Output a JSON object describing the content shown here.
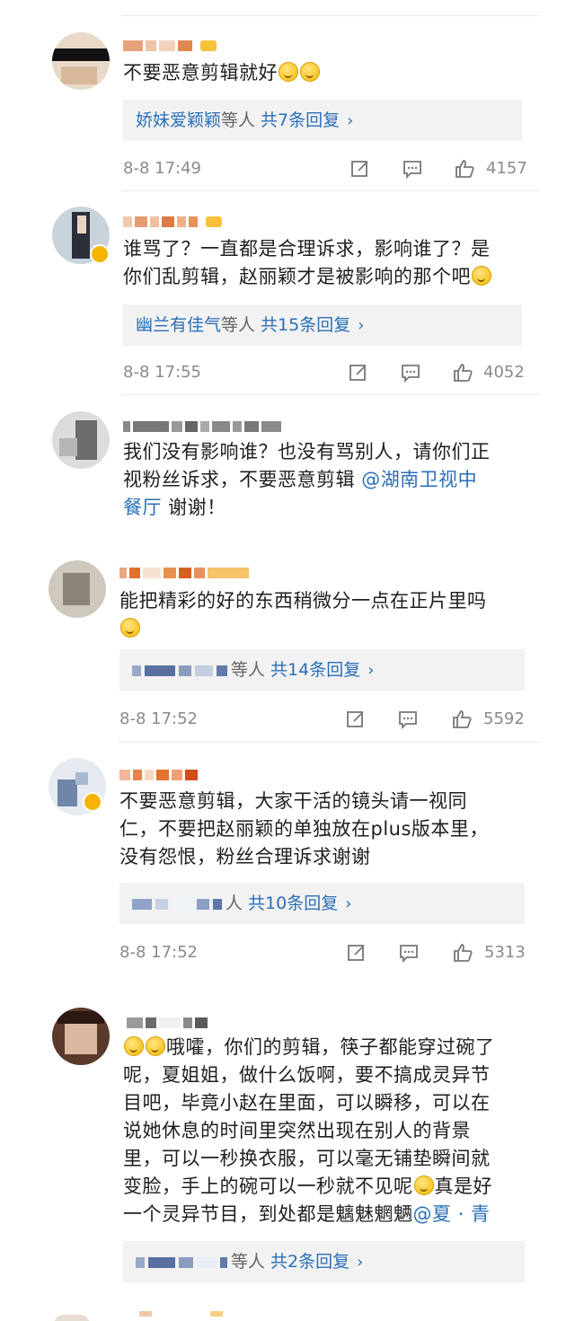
{
  "comments": [
    {
      "text": "不要恶意剪辑就好",
      "emojis_after": 2,
      "reply_names": "娇妹爱颖颖",
      "reply_mid": "等人",
      "reply_count": "共7条回复",
      "time": "8-8 17:49",
      "likes": "4157"
    },
    {
      "text": "谁骂了？一直都是合理诉求，影响谁了？是你们乱剪辑，赵丽颖才是被影响的那个吧",
      "line1": "谁骂了？一直都是合理诉求，影响谁了？是",
      "line2": "你们乱剪辑，赵丽颖才是被影响的那个吧",
      "reply_names": "幽兰有佳气",
      "reply_mid": "等人",
      "reply_count": "共15条回复",
      "time": "8-8 17:55",
      "likes": "4052"
    },
    {
      "line1": "我们没有影响谁？也没有骂别人，请你们正",
      "line2a": "视粉丝诉求，不要恶意剪辑 ",
      "mention": "@湖南卫视中",
      "line3a": "餐厅",
      "line3b": " 谢谢！"
    },
    {
      "line1": "能把精彩的好的东西稍微分一点在正片里吗",
      "reply_mid": "等人",
      "reply_count": "共14条回复",
      "time": "8-8 17:52",
      "likes": "5592"
    },
    {
      "line1": "不要恶意剪辑，大家干活的镜头请一视同",
      "line2": "仁，不要把赵丽颖的单独放在plus版本里，",
      "line3": "没有怨恨，粉丝合理诉求谢谢",
      "reply_mid": "人",
      "reply_count": "共10条回复",
      "time": "8-8 17:52",
      "likes": "5313"
    },
    {
      "line1": "哦嚯，你们的剪辑，筷子都能穿过碗了",
      "line2": "呢，夏姐姐，做什么饭啊，要不搞成灵异节",
      "line3": "目吧，毕竟小赵在里面，可以瞬移，可以在",
      "line4": "说她休息的时间里突然出现在别人的背景",
      "line5": "里，可以一秒换衣服，可以毫无铺垫瞬间就",
      "line6a": "变脸，手上的碗可以一秒就不见呢",
      "line6b": "真是好",
      "line7a": "一个灵异节目，到处都是魑魅魍魉",
      "mention": "@夏 · 青",
      "reply_mid": "等人",
      "reply_count": "共2条回复"
    }
  ],
  "colors": {
    "link": "#2a6fb8",
    "reply_bg": "#f2f2f2",
    "meta": "#8a8a8a",
    "badge": "#f5b400"
  },
  "icons": [
    "edit-icon",
    "comment-icon",
    "like-icon",
    "chevron-right-icon",
    "emoji-smile-icon",
    "verified-badge-icon"
  ]
}
